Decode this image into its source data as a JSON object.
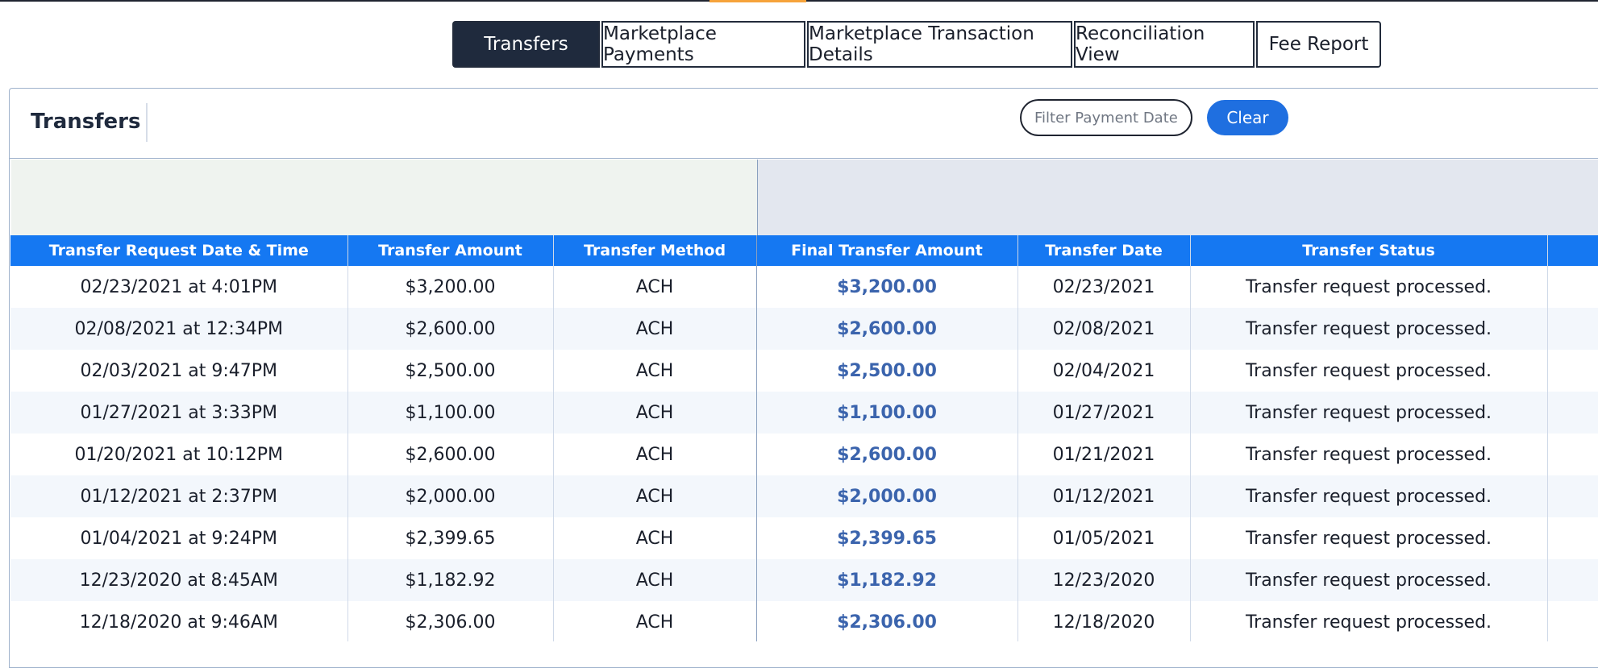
{
  "tabs": [
    {
      "label": "Transfers",
      "active": true
    },
    {
      "label": "Marketplace Payments",
      "active": false
    },
    {
      "label": "Marketplace Transaction Details",
      "active": false
    },
    {
      "label": "Reconciliation View",
      "active": false
    },
    {
      "label": "Fee Report",
      "active": false
    }
  ],
  "panel": {
    "title": "Transfers"
  },
  "filter": {
    "placeholder": "Filter Payment Date",
    "value": "",
    "clear_label": "Clear"
  },
  "table": {
    "columns": [
      "Transfer Request Date & Time",
      "Transfer Amount",
      "Transfer Method",
      "Final Transfer Amount",
      "Transfer Date",
      "Transfer Status",
      ""
    ],
    "rows": [
      [
        "02/23/2021 at 4:01PM",
        "$3,200.00",
        "ACH",
        "$3,200.00",
        "02/23/2021",
        "Transfer request processed."
      ],
      [
        "02/08/2021 at 12:34PM",
        "$2,600.00",
        "ACH",
        "$2,600.00",
        "02/08/2021",
        "Transfer request processed."
      ],
      [
        "02/03/2021 at 9:47PM",
        "$2,500.00",
        "ACH",
        "$2,500.00",
        "02/04/2021",
        "Transfer request processed."
      ],
      [
        "01/27/2021 at 3:33PM",
        "$1,100.00",
        "ACH",
        "$1,100.00",
        "01/27/2021",
        "Transfer request processed."
      ],
      [
        "01/20/2021 at 10:12PM",
        "$2,600.00",
        "ACH",
        "$2,600.00",
        "01/21/2021",
        "Transfer request processed."
      ],
      [
        "01/12/2021 at 2:37PM",
        "$2,000.00",
        "ACH",
        "$2,000.00",
        "01/12/2021",
        "Transfer request processed."
      ],
      [
        "01/04/2021 at 9:24PM",
        "$2,399.65",
        "ACH",
        "$2,399.65",
        "01/05/2021",
        "Transfer request processed."
      ],
      [
        "12/23/2020 at 8:45AM",
        "$1,182.92",
        "ACH",
        "$1,182.92",
        "12/23/2020",
        "Transfer request processed."
      ],
      [
        "12/18/2020 at 9:46AM",
        "$2,306.00",
        "ACH",
        "$2,306.00",
        "12/18/2020",
        "Transfer request processed."
      ]
    ]
  },
  "colors": {
    "header_blue": "#1578f2",
    "active_tab": "#1f2a3d",
    "final_amount": "#3b64ad",
    "clear_button": "#1f6fe0"
  }
}
